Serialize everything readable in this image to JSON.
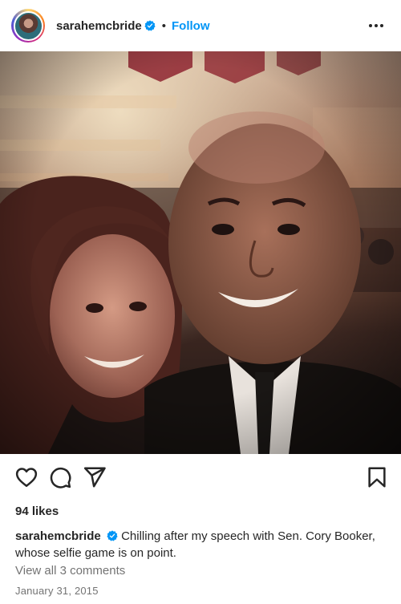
{
  "post": {
    "username": "sarahemcbride",
    "separator": "•",
    "follow_label": "Follow",
    "likes": "94 likes",
    "caption_text": "Chilling after my speech with Sen. Cory Booker, whose selfie game is on point.",
    "view_comments": "View all 3 comments",
    "date": "January 31, 2015"
  },
  "icons": {
    "verified": "verified-badge-icon",
    "more": "more-options-icon",
    "like": "heart-icon",
    "comment": "comment-icon",
    "share": "share-icon",
    "save": "bookmark-icon"
  },
  "colors": {
    "accent": "#0095f6",
    "text": "#262626",
    "secondary": "#737373"
  }
}
